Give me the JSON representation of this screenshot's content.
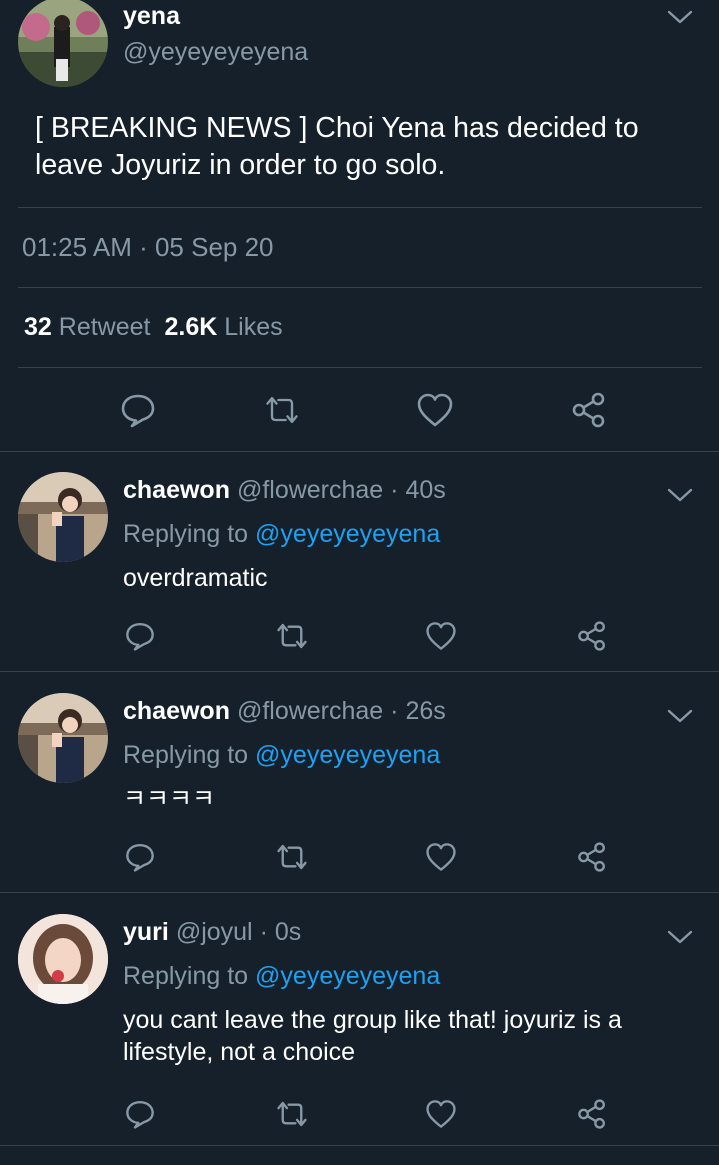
{
  "main_tweet": {
    "name": "yena",
    "handle": "@yeyeyeyeyena",
    "text": "[ BREAKING NEWS ] Choi Yena has decided to leave Joyuriz in order to go solo.",
    "timestamp": "01:25 AM · 05 Sep 20",
    "retweet_count": "32",
    "retweet_label": "Retweet",
    "like_count": "2.6K",
    "like_label": "Likes"
  },
  "replies": [
    {
      "name": "chaewon",
      "handle": "@flowerchae",
      "time": "· 40s",
      "replying_prefix": "Replying to",
      "replying_to": "@yeyeyeyeyena",
      "text": "overdramatic"
    },
    {
      "name": "chaewon",
      "handle": "@flowerchae",
      "time": "· 26s",
      "replying_prefix": "Replying to",
      "replying_to": "@yeyeyeyeyena",
      "text": "ㅋㅋㅋㅋ"
    },
    {
      "name": "yuri",
      "handle": "@joyul",
      "time": "· 0s",
      "replying_prefix": "Replying to",
      "replying_to": "@yeyeyeyeyena",
      "text": "you cant leave the group like that! joyuriz is a lifestyle, not a choice"
    }
  ],
  "icons": {
    "reply": "reply-icon",
    "retweet": "retweet-icon",
    "like": "heart-icon",
    "share": "share-icon",
    "menu": "chevron-down-icon"
  },
  "colors": {
    "background": "#15202b",
    "divider": "#38444d",
    "secondary_text": "#8899a6",
    "link": "#1da1f2",
    "icon": "#8899a6"
  }
}
